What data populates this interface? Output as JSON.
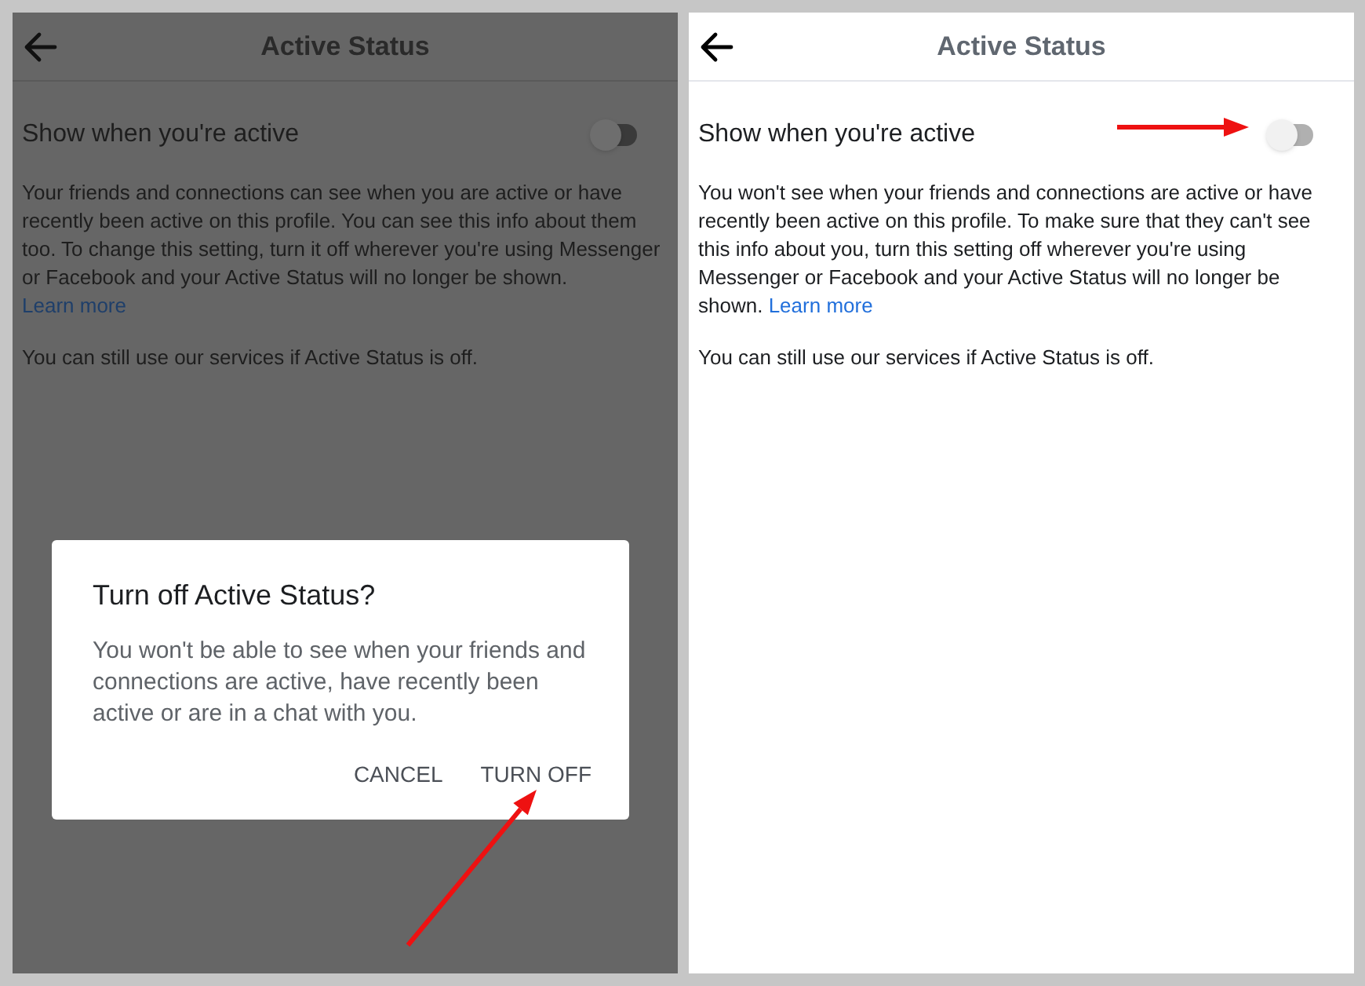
{
  "screens": [
    {
      "dimmed": true,
      "title": "Active Status",
      "setting": {
        "label": "Show when you're active",
        "on": false
      },
      "description": "Your friends and connections can see when you are active or have recently been active on this profile. You can see this info about them too. To change this setting, turn it off wherever you're using Messenger or Facebook and your Active Status will no longer be shown.",
      "link": "Learn more",
      "note": "You can still use our services if Active Status is off.",
      "dialog": {
        "title": "Turn off Active Status?",
        "message": "You won't be able to see when your friends and connections are active, have recently been active or are in a chat with you.",
        "buttons": [
          "CANCEL",
          "TURN OFF"
        ]
      }
    },
    {
      "dimmed": false,
      "title": "Active Status",
      "setting": {
        "label": "Show when you're active",
        "on": false
      },
      "description": "You won't see when your friends and connections are active or have recently been active on this profile. To make sure that they can't see this info about you, turn this setting off wherever you're using Messenger or Facebook and your Active Status will no longer be shown.",
      "link": "Learn more",
      "note": "You can still use our services if Active Status is off."
    }
  ]
}
